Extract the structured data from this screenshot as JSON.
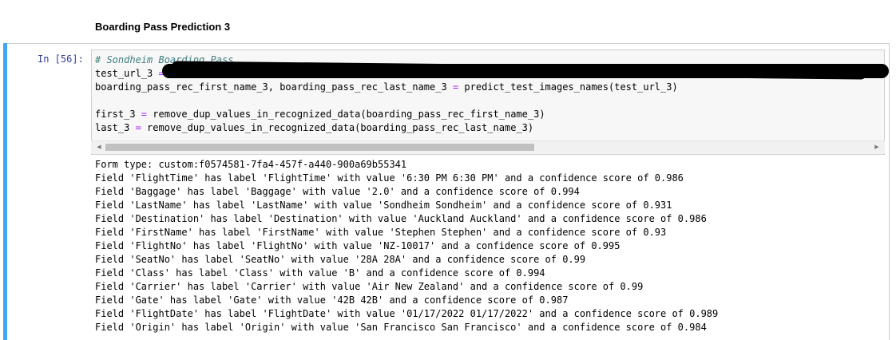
{
  "heading": "Boarding Pass Prediction 3",
  "cell": {
    "prompt": "In [56]:",
    "code": {
      "comment": "# Sondheim Boarding Pass",
      "line2_var": "test_url_3",
      "line2_eq": " = ",
      "line3_lhs": "boarding_pass_rec_first_name_3, boarding_pass_rec_last_name_3",
      "line3_eq": " = ",
      "line3_rhs": "predict_test_images_names(test_url_3)",
      "line5_lhs": "first_3",
      "line5_eq": " = ",
      "line5_rhs": "remove_dup_values_in_recognized_data(boarding_pass_rec_first_name_3)",
      "line6_lhs": "last_3",
      "line6_eq": " = ",
      "line6_rhs": "remove_dup_values_in_recognized_data(boarding_pass_rec_last_name_3)"
    }
  },
  "output": {
    "lines": [
      "Form type: custom:f0574581-7fa4-457f-a440-900a69b55341",
      "Field 'FlightTime' has label 'FlightTime' with value '6:30 PM 6:30 PM' and a confidence score of 0.986",
      "Field 'Baggage' has label 'Baggage' with value '2.0' and a confidence score of 0.994",
      "Field 'LastName' has label 'LastName' with value 'Sondheim Sondheim' and a confidence score of 0.931",
      "Field 'Destination' has label 'Destination' with value 'Auckland Auckland' and a confidence score of 0.986",
      "Field 'FirstName' has label 'FirstName' with value 'Stephen Stephen' and a confidence score of 0.93",
      "Field 'FlightNo' has label 'FlightNo' with value 'NZ-10017' and a confidence score of 0.995",
      "Field 'SeatNo' has label 'SeatNo' with value '28A 28A' and a confidence score of 0.99",
      "Field 'Class' has label 'Class' with value 'B' and a confidence score of 0.994",
      "Field 'Carrier' has label 'Carrier' with value 'Air New Zealand' and a confidence score of 0.99",
      "Field 'Gate' has label 'Gate' with value '42B 42B' and a confidence score of 0.987",
      "Field 'FlightDate' has label 'FlightDate' with value '01/17/2022 01/17/2022' and a confidence score of 0.989",
      "Field 'Origin' has label 'Origin' with value 'San Francisco San Francisco' and a confidence score of 0.984"
    ]
  },
  "scrollbar": {
    "left_arrow_icon": "triangle-left",
    "right_arrow_icon": "triangle-right"
  },
  "colors": {
    "cell_accent": "#42a5f5",
    "prompt": "#303f9f",
    "comment": "#408080",
    "operator": "#aa22ff"
  }
}
